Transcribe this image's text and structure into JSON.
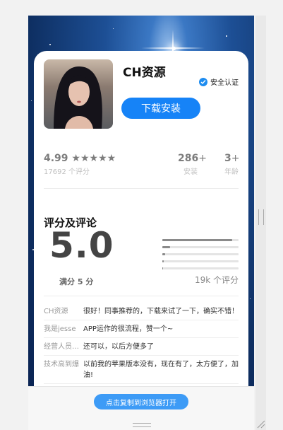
{
  "app": {
    "name": "CH资源",
    "verified_label": "安全认证",
    "download_label": "下载安装"
  },
  "stats": {
    "rating": "4.99",
    "stars": "★★★★★",
    "rating_count": "17692 个评分",
    "downloads": "286",
    "downloads_plus": "+",
    "downloads_label": "安装",
    "age": "3",
    "age_plus": "+",
    "age_label": "年龄"
  },
  "ratings": {
    "title": "评分及评论",
    "score": "5.0",
    "score_sub": "满分 5 分",
    "count_label": "19k 个评分",
    "distribution": [
      0.92,
      0.1,
      0.04,
      0.02,
      0.01
    ]
  },
  "reviews": [
    {
      "user": "CH资源",
      "text": "很好！同事推荐的，下载来试了一下，确实不错！"
    },
    {
      "user": "我是jesse",
      "text": "APP运作的很流程，赞一个~"
    },
    {
      "user": "经营人员20...",
      "text": "还可以，以后方便多了"
    },
    {
      "user": "技术高到爆",
      "text": "以前我的苹果版本没有，现在有了，太方便了，加油!"
    }
  ],
  "footer": {
    "open_label": "点击复制到浏览器打开"
  },
  "colors": {
    "accent": "#1683f7",
    "verified": "#1d8cf0"
  }
}
